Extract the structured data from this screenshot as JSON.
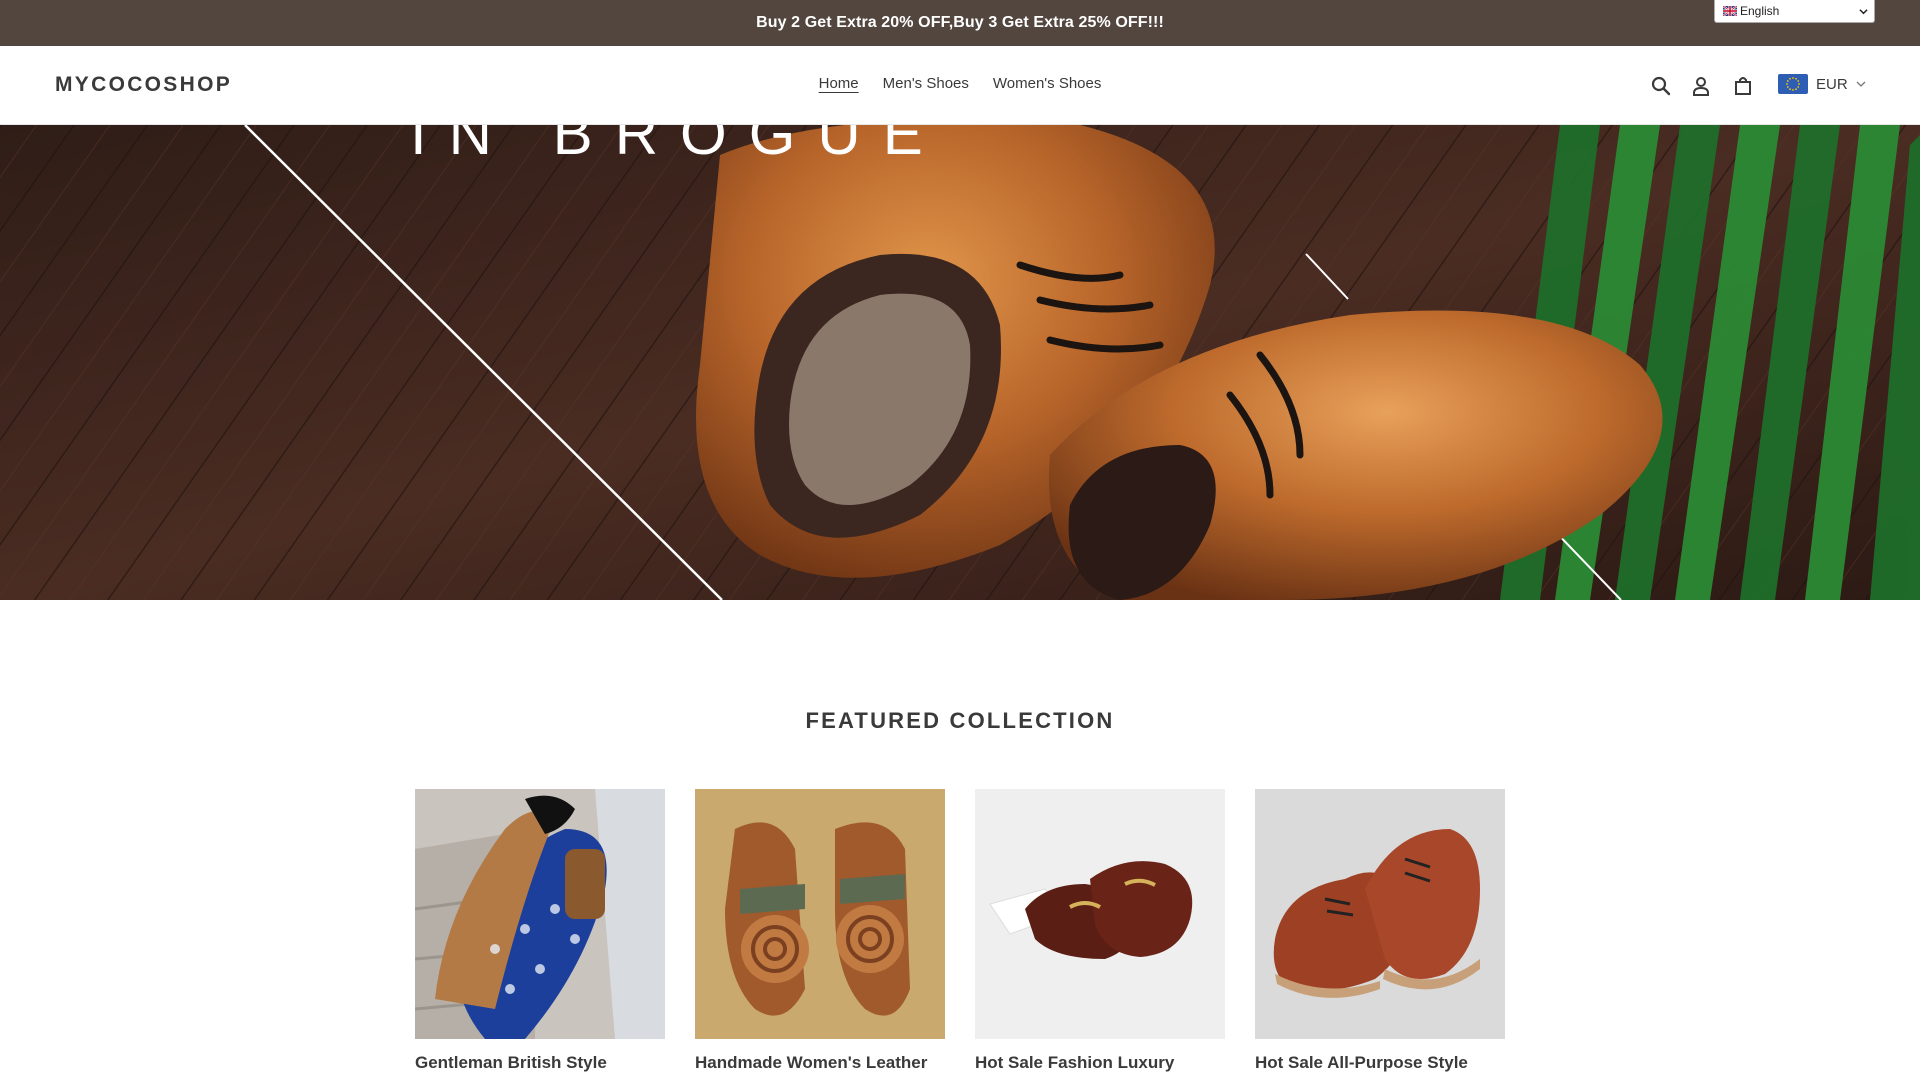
{
  "announcement": {
    "text": "Buy 2 Get Extra 20% OFF,Buy 3 Get Extra 25% OFF!!!"
  },
  "language": {
    "selected": "English"
  },
  "header": {
    "logo": "MYCOCOSHOP",
    "nav": [
      {
        "label": "Home",
        "active": true
      },
      {
        "label": "Men's Shoes",
        "active": false
      },
      {
        "label": "Women's Shoes",
        "active": false
      }
    ],
    "icons": [
      "search-icon",
      "account-icon",
      "cart-icon"
    ],
    "currency": "EUR"
  },
  "hero": {
    "title": "IN BROGUE"
  },
  "featured": {
    "title": "FEATURED COLLECTION",
    "products": [
      {
        "title": "Gentleman British Style"
      },
      {
        "title": "Handmade Women's Leather"
      },
      {
        "title": "Hot Sale Fashion Luxury"
      },
      {
        "title": "Hot Sale All-Purpose Style"
      }
    ]
  },
  "colors": {
    "announcement_bg": "#53463f",
    "text": "#3a3a3a",
    "hero_wood": "#3a241c",
    "currency_flag": "#2d5eb3"
  }
}
